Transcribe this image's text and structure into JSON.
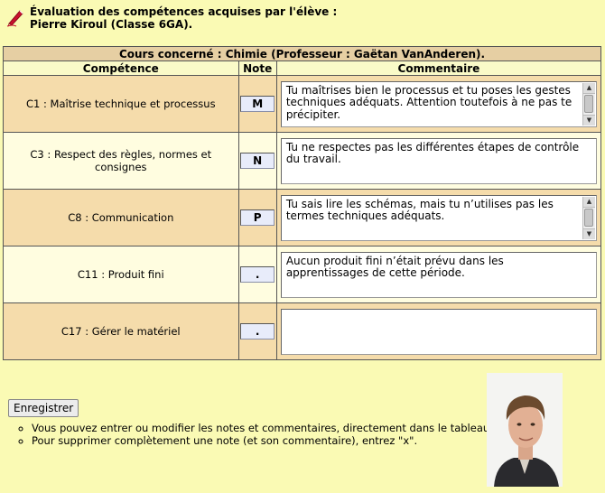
{
  "header": {
    "line1": "Évaluation des compétences acquises par l'élève :",
    "line2": "Pierre Kiroul (Classe 6GA)."
  },
  "table": {
    "course_title": "Cours concerné : Chimie (Professeur : Gaëtan VanAnderen).",
    "columns": [
      "Compétence",
      "Note",
      "Commentaire"
    ],
    "rows": [
      {
        "competence": "C1 : Maîtrise technique et processus",
        "note": "M",
        "comment": "Tu maîtrises bien le processus et tu poses les gestes techniques adéquats. Attention toutefois à ne pas te précipiter."
      },
      {
        "competence": "C3 : Respect des règles, normes et consignes",
        "note": "N",
        "comment": "Tu ne respectes pas les différentes étapes de contrôle du travail."
      },
      {
        "competence": "C8 : Communication",
        "note": "P",
        "comment": "Tu sais lire les schémas, mais tu n’utilises pas les termes techniques adéquats."
      },
      {
        "competence": "C11 : Produit fini",
        "note": ".",
        "comment": "Aucun produit fini n’était prévu dans les apprentissages de cette période."
      },
      {
        "competence": "C17 : Gérer le matériel",
        "note": ".",
        "comment": ""
      }
    ]
  },
  "save_label": "Enregistrer",
  "tips": [
    "Vous pouvez entrer ou modifier les notes et commentaires, directement dans le tableau.",
    "Pour supprimer complètement une note (et son commentaire), entrez \"x\"."
  ],
  "colors": {
    "background": "#fafab4",
    "row_tan": "#f5dcab",
    "row_cream": "#fffde0",
    "icon_red": "#c8102e"
  },
  "icons": {
    "header": "pencil-icon",
    "photo": "student-photo"
  }
}
